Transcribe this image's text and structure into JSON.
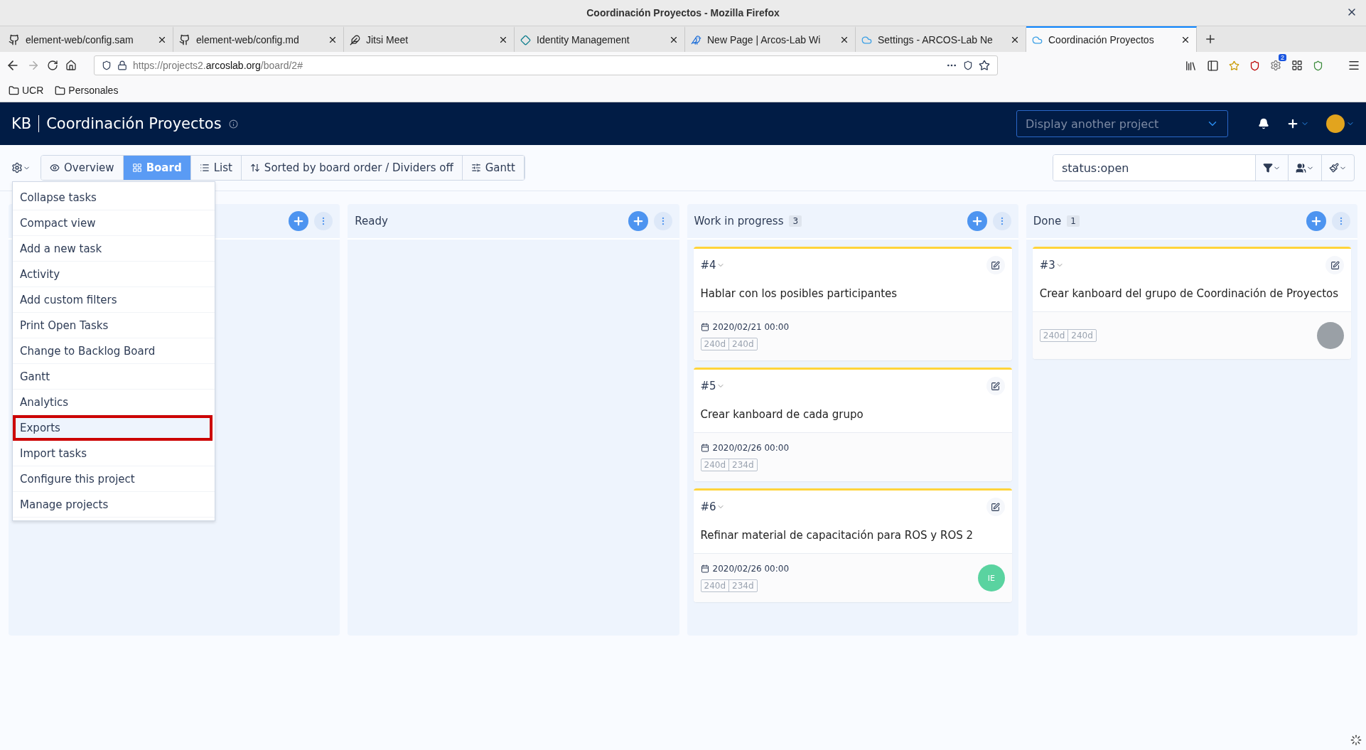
{
  "window": {
    "title": "Coordinación Proyectos - Mozilla Firefox"
  },
  "browser_tabs": [
    {
      "label": "element-web/config.sam",
      "kind": "github",
      "selected": false
    },
    {
      "label": "element-web/config.md",
      "kind": "github",
      "selected": false
    },
    {
      "label": "Jitsi Meet",
      "kind": "feather",
      "selected": false
    },
    {
      "label": "Identity Management",
      "kind": "diamond",
      "selected": false
    },
    {
      "label": "New Page | Arcos-Lab Wi",
      "kind": "wiki",
      "selected": false
    },
    {
      "label": "Settings - ARCOS-Lab Ne",
      "kind": "cloud",
      "selected": false
    },
    {
      "label": "Coordinación Proyectos",
      "kind": "cloud",
      "selected": true
    }
  ],
  "address_bar": {
    "url_prefix": "https://projects2.",
    "url_domain": "arcoslab.org",
    "url_path": "/board/2#"
  },
  "extension_badge": "2",
  "bookmarks": [
    "UCR",
    "Personales"
  ],
  "header": {
    "logo": "KB",
    "project": "Coordinación Proyectos",
    "project_select": {
      "placeholder": "Display another project"
    }
  },
  "view_tabs": [
    {
      "label": "Overview",
      "kind": "eye",
      "selected": false
    },
    {
      "label": "Board",
      "kind": "grid",
      "selected": true
    },
    {
      "label": "List",
      "kind": "list",
      "selected": false
    },
    {
      "label": "Sorted by board order / Dividers off",
      "kind": "sort",
      "selected": false
    },
    {
      "label": "Gantt",
      "kind": "sliders",
      "selected": false
    }
  ],
  "search": {
    "value": "status:open"
  },
  "menu": {
    "items": [
      {
        "label": "Collapse tasks",
        "highlighted": false
      },
      {
        "label": "Compact view",
        "highlighted": false
      },
      {
        "label": "Add a new task",
        "highlighted": false
      },
      {
        "label": "Activity",
        "highlighted": false
      },
      {
        "label": "Add custom filters",
        "highlighted": false
      },
      {
        "label": "Print Open Tasks",
        "highlighted": false
      },
      {
        "label": "Change to Backlog Board",
        "highlighted": false
      },
      {
        "label": "Gantt",
        "highlighted": false
      },
      {
        "label": "Analytics",
        "highlighted": false
      },
      {
        "label": "Exports",
        "highlighted": true
      },
      {
        "label": "Import tasks",
        "highlighted": false
      },
      {
        "label": "Configure this project",
        "highlighted": false
      },
      {
        "label": "Manage projects",
        "highlighted": false
      }
    ]
  },
  "columns": [
    {},
    {
      "title": "Ready"
    },
    {
      "title": "Work in progress",
      "count": "3",
      "cards": [
        {
          "id": "#4",
          "title": "Hablar con los posibles participantes",
          "date": "2020/02/21 00:00",
          "estimate": "240d",
          "spent": "240d",
          "color": "#ffd43b"
        },
        {
          "id": "#5",
          "title": "Crear kanboard de cada grupo",
          "date": "2020/02/26 00:00",
          "estimate": "240d",
          "spent": "234d",
          "color": "#ffd43b"
        },
        {
          "id": "#6",
          "title": "Refinar material de capacitación para ROS y ROS 2",
          "date": "2020/02/26 00:00",
          "estimate": "240d",
          "spent": "234d",
          "color": "#ffd43b",
          "assignee": {
            "kind": "initials",
            "text": "IE"
          }
        }
      ]
    },
    {
      "title": "Done",
      "count": "1",
      "cards": [
        {
          "id": "#3",
          "title": "Crear kanboard del grupo de Coordinación de Proyectos",
          "estimate": "240d",
          "spent": "240d",
          "color": "#ffd43b",
          "assignee": {
            "kind": "photo"
          }
        }
      ]
    }
  ]
}
